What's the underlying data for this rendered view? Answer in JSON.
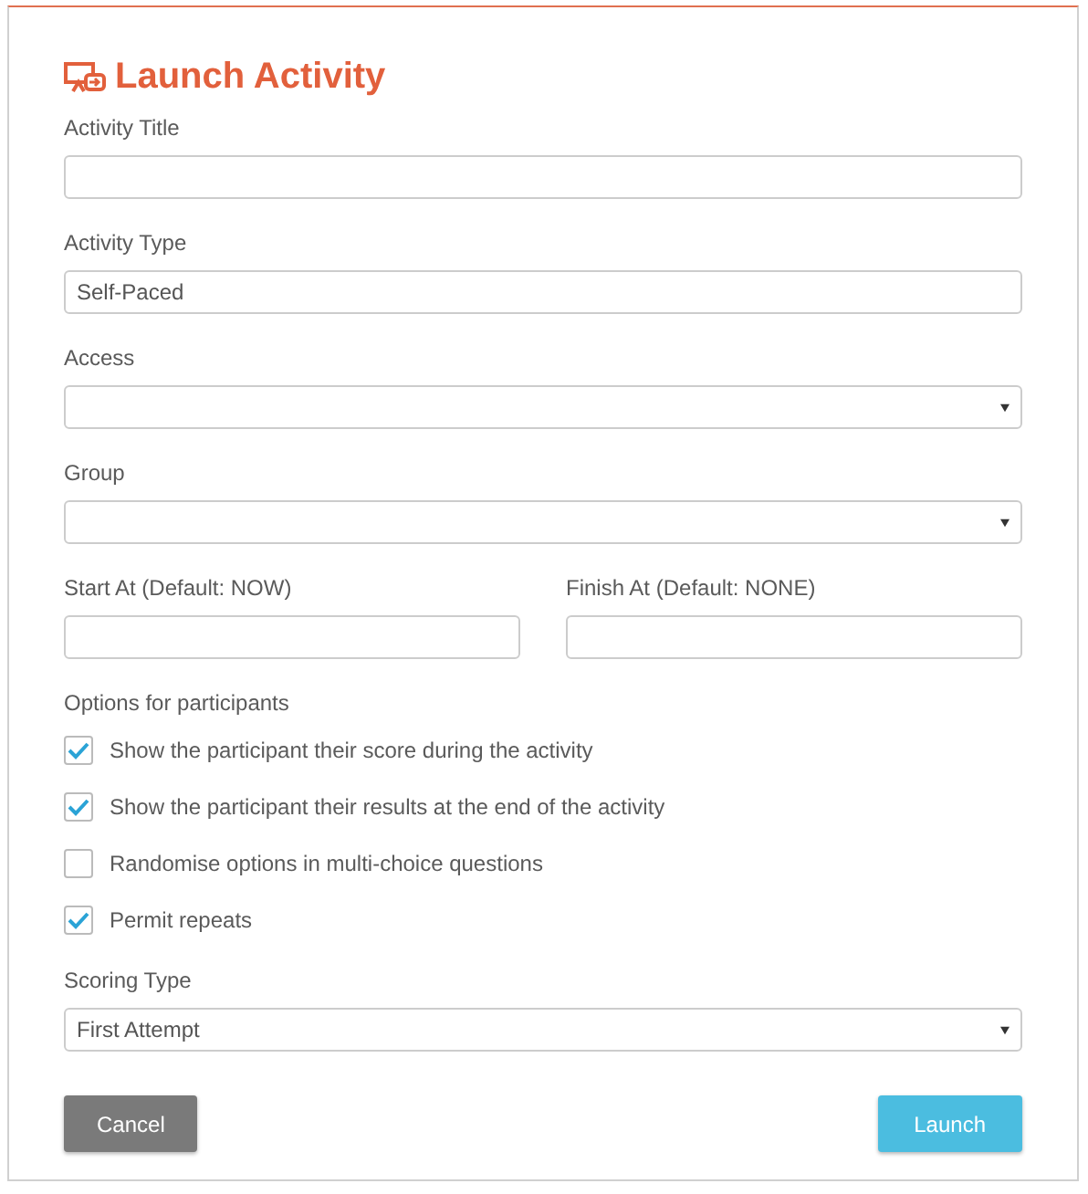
{
  "dialog": {
    "title": "Launch Activity"
  },
  "fields": [
    {
      "label": "Activity Title",
      "kind": "text"
    },
    {
      "label": "Activity Type",
      "kind": "text",
      "value": "Self-Paced"
    },
    {
      "label": "Access",
      "kind": "select"
    },
    {
      "label": "Group",
      "kind": "select"
    }
  ],
  "date_fields": [
    {
      "label": "Start At (Default: NOW)"
    },
    {
      "label": "Finish At (Default: NONE)"
    }
  ],
  "options_heading": "Options for participants",
  "options": [
    {
      "label": "Show the participant their score during the activity",
      "checked": true
    },
    {
      "label": "Show the participant their results at the end of the activity",
      "checked": true
    },
    {
      "label": "Randomise options in multi-choice questions",
      "checked": false
    },
    {
      "label": "Permit repeats",
      "checked": true
    }
  ],
  "scoring": {
    "label": "Scoring Type",
    "kind": "select",
    "value": "First Attempt"
  },
  "buttons": [
    {
      "label": "Cancel",
      "kind": "secondary"
    },
    {
      "label": "Launch",
      "kind": "primary"
    }
  ]
}
